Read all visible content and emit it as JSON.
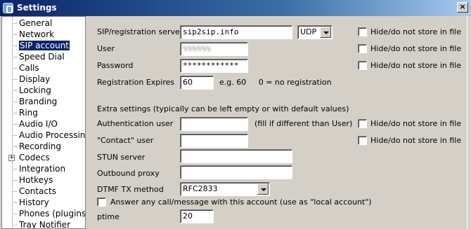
{
  "window": {
    "title": "Settings",
    "close_glyph": "×",
    "icon": "app-icon"
  },
  "sidebar": {
    "items": [
      {
        "label": "General"
      },
      {
        "label": "Network"
      },
      {
        "label": "SIP account",
        "selected": true
      },
      {
        "label": "Speed Dial"
      },
      {
        "label": "Calls"
      },
      {
        "label": "Display"
      },
      {
        "label": "Locking"
      },
      {
        "label": "Branding"
      },
      {
        "label": "Ring"
      },
      {
        "label": "Audio I/O"
      },
      {
        "label": "Audio Processing"
      },
      {
        "label": "Recording"
      },
      {
        "label": "Codecs",
        "expandable": true,
        "expander_glyph": "+"
      },
      {
        "label": "Integration"
      },
      {
        "label": "Hotkeys"
      },
      {
        "label": "Contacts"
      },
      {
        "label": "History"
      },
      {
        "label": "Phones (plugins)"
      },
      {
        "label": "Tray Notifier"
      }
    ]
  },
  "form": {
    "sip_server_label": "SIP/registration server",
    "sip_server_value": "sip2sip.info",
    "transport_value": "UDP",
    "user_label": "User",
    "user_value": "%%%%%%",
    "password_label": "Password",
    "password_value": "************",
    "reg_expires_label": "Registration Expires",
    "reg_expires_value": "60",
    "reg_expires_hint": "e.g. 60     0 = no registration",
    "extra_heading": "Extra settings (typically can be left empty or with default values)",
    "auth_user_label": "Authentication user",
    "auth_user_value": "",
    "auth_user_hint": "(fill if different than User)",
    "contact_user_label": "\"Contact\" user",
    "contact_user_value": "",
    "stun_label": "STUN server",
    "stun_value": "",
    "proxy_label": "Outbound proxy",
    "proxy_value": "",
    "dtmf_label": "DTMF TX method",
    "dtmf_value": "RFC2833",
    "local_account_label": "Answer any call/message with this account (use as \"local account\")",
    "local_account_checked": false,
    "ptime_label": "ptime",
    "ptime_value": "20",
    "hide_label": "Hide/do not store in file"
  }
}
